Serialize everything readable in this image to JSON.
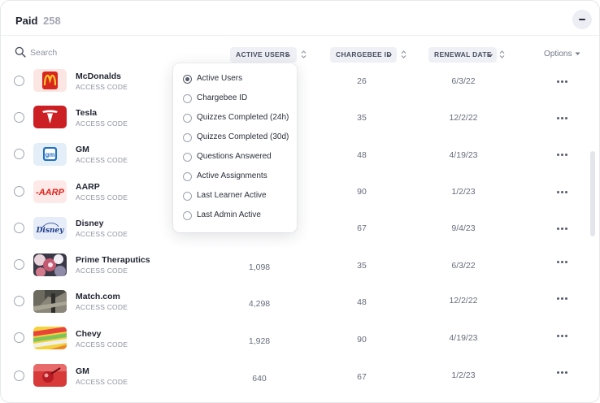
{
  "header": {
    "title": "Paid",
    "count": "258"
  },
  "search": {
    "placeholder": "Search"
  },
  "columns": {
    "active_users": "ACTIVE USERS",
    "chargebee_id": "CHARGEBEE ID",
    "renewal_date": "RENEWAL DATE",
    "options": "Options"
  },
  "rows": [
    {
      "name": "McDonalds",
      "sub": "ACCESS CODE",
      "logo": "mcdonalds-logo",
      "active_users": "",
      "chargebee_id": "26",
      "renewal_date": "6/3/22"
    },
    {
      "name": "Tesla",
      "sub": "ACCESS CODE",
      "logo": "tesla-logo",
      "active_users": "",
      "chargebee_id": "35",
      "renewal_date": "12/2/22"
    },
    {
      "name": "GM",
      "sub": "ACCESS CODE",
      "logo": "gm-logo",
      "active_users": "",
      "chargebee_id": "48",
      "renewal_date": "4/19/23"
    },
    {
      "name": "AARP",
      "sub": "ACCESS CODE",
      "logo": "aarp-logo",
      "active_users": "",
      "chargebee_id": "90",
      "renewal_date": "1/2/23"
    },
    {
      "name": "Disney",
      "sub": "ACCESS CODE",
      "logo": "disney-logo",
      "active_users": "",
      "chargebee_id": "67",
      "renewal_date": "9/4/23"
    },
    {
      "name": "Prime Theraputics",
      "sub": "ACCESS CODE",
      "logo": "prime-therapeutics-image",
      "active_users": "1,098",
      "chargebee_id": "35",
      "renewal_date": "6/3/22"
    },
    {
      "name": "Match.com",
      "sub": "ACCESS CODE",
      "logo": "match-image",
      "active_users": "4,298",
      "chargebee_id": "48",
      "renewal_date": "12/2/22"
    },
    {
      "name": "Chevy",
      "sub": "ACCESS CODE",
      "logo": "chevy-image",
      "active_users": "1,928",
      "chargebee_id": "90",
      "renewal_date": "4/19/23"
    },
    {
      "name": "GM",
      "sub": "ACCESS CODE",
      "logo": "gm-red-image",
      "active_users": "640",
      "chargebee_id": "67",
      "renewal_date": "1/2/23"
    }
  ],
  "dropdown": {
    "selected": "Active Users",
    "items": [
      "Active Users",
      "Chargebee ID",
      "Quizzes Completed (24h)",
      "Quizzes Completed (30d)",
      "Questions Answered",
      "Active Assignments",
      "Last Learner Active",
      "Last Admin Active"
    ]
  },
  "colors": {
    "accent_bg": "#eef0f5",
    "text_primary": "#1f2330",
    "text_muted": "#8e93a0",
    "mcdonalds_red": "#d7261e",
    "tesla_red": "#cc1f24",
    "gm_blue": "#1f6fc2",
    "aarp_red": "#e2231a",
    "disney_blue": "#1d3b8a"
  }
}
